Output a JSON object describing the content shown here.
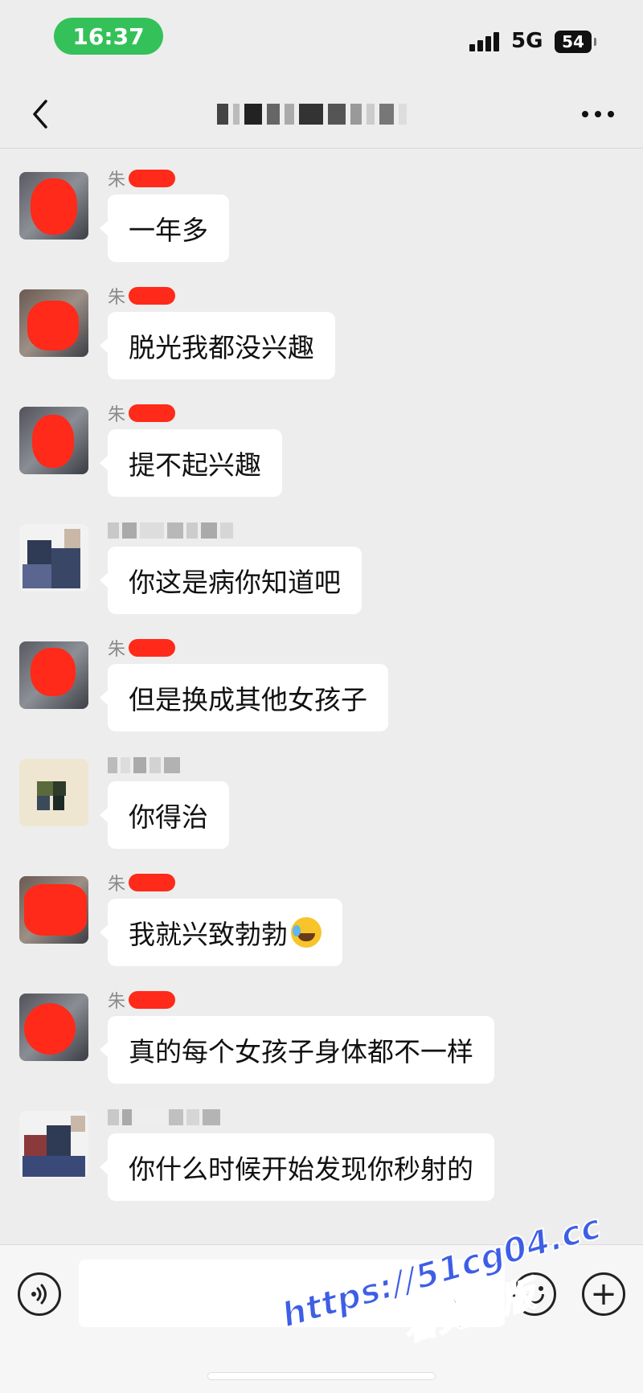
{
  "status_bar": {
    "time": "16:37",
    "network": "5G",
    "battery": "54",
    "accent": "#35c15a"
  },
  "nav": {
    "back_icon": "chevron-left-icon",
    "more_icon": "ellipsis-icon"
  },
  "messages": [
    {
      "sender": "朱",
      "text": "一年多"
    },
    {
      "sender": "朱",
      "text": "脱光我都没兴趣"
    },
    {
      "sender": "朱",
      "text": "提不起兴趣"
    },
    {
      "sender": "",
      "text": "你这是病你知道吧"
    },
    {
      "sender": "朱",
      "text": "但是换成其他女孩子"
    },
    {
      "sender": "",
      "text": "你得治"
    },
    {
      "sender": "朱",
      "text": "我就兴致勃勃"
    },
    {
      "sender": "朱",
      "text": "真的每个女孩子身体都不一样"
    },
    {
      "sender": "",
      "text": "你什么时候开始发现你秒射的"
    }
  ],
  "input_bar": {
    "voice_icon": "voice-icon",
    "emoji_icon": "emoji-icon",
    "plus_icon": "plus-icon",
    "plus_glyph": "+"
  },
  "watermark": {
    "line1": "https://51cg04.cc",
    "line2": "看完整版"
  }
}
